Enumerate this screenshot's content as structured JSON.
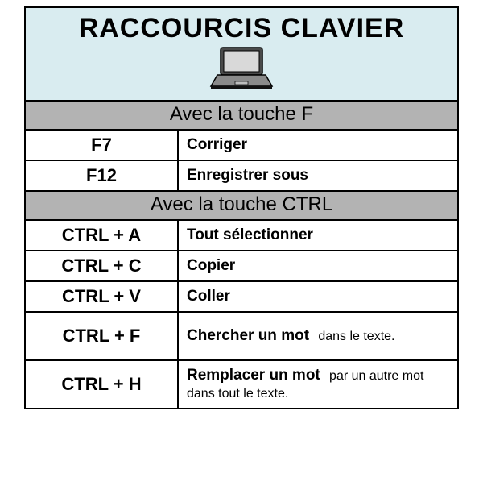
{
  "title": "RACCOURCIS CLAVIER",
  "sections": [
    {
      "heading": "Avec la touche F",
      "rows": [
        {
          "key": "F7",
          "desc_bold": "Corriger",
          "desc_rest": ""
        },
        {
          "key": "F12",
          "desc_bold": "Enregistrer sous",
          "desc_rest": ""
        }
      ]
    },
    {
      "heading": "Avec la touche CTRL",
      "rows": [
        {
          "key": "CTRL + A",
          "desc_bold": "Tout sélectionner",
          "desc_rest": ""
        },
        {
          "key": "CTRL + C",
          "desc_bold": "Copier",
          "desc_rest": ""
        },
        {
          "key": "CTRL + V",
          "desc_bold": "Coller",
          "desc_rest": ""
        },
        {
          "key": "CTRL + F",
          "desc_bold": "Chercher un mot",
          "desc_rest": "dans le texte."
        },
        {
          "key": "CTRL + H",
          "desc_bold": "Remplacer un mot",
          "desc_rest": "par un autre mot dans tout le texte."
        }
      ]
    }
  ]
}
